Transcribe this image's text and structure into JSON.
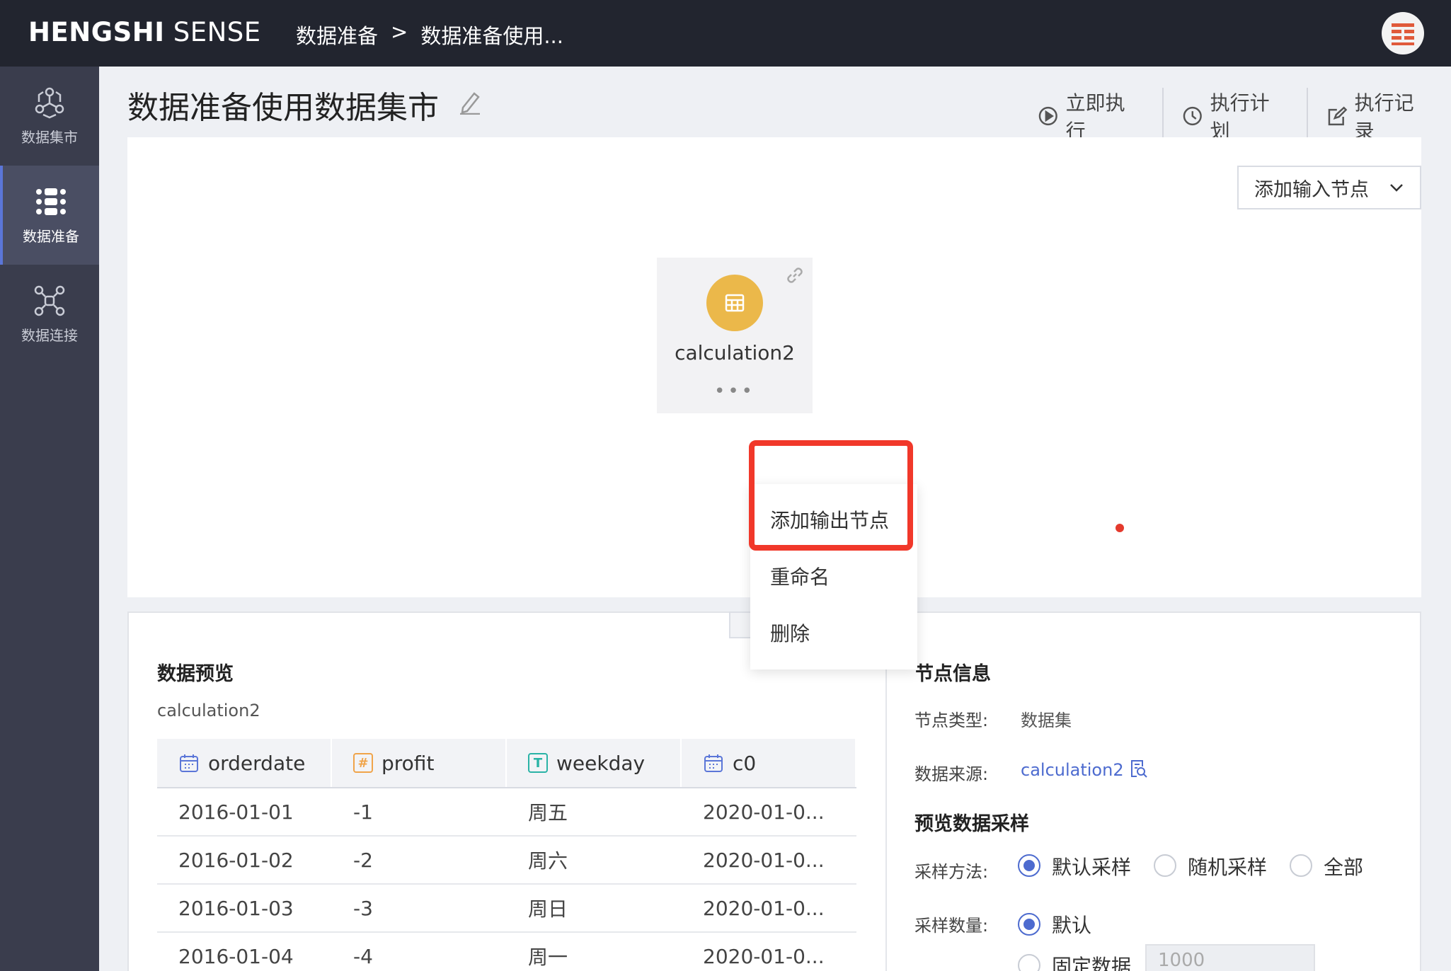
{
  "header": {
    "brand_bold": "HENGSHI",
    "brand_light": " SENSE",
    "breadcrumb": [
      "数据准备",
      ">",
      "数据准备使用..."
    ]
  },
  "sidebar": {
    "items": [
      {
        "label": "数据集市",
        "icon": "hex-network-icon",
        "active": false
      },
      {
        "label": "数据准备",
        "icon": "prep-flow-icon",
        "active": true
      },
      {
        "label": "数据连接",
        "icon": "connection-graph-icon",
        "active": false
      }
    ]
  },
  "page": {
    "title": "数据准备使用数据集市",
    "toolbar": {
      "run_now": "立即执行",
      "schedule": "执行计划",
      "log": "执行记录"
    }
  },
  "canvas": {
    "add_input_label": "添加输入节点",
    "node": {
      "label": "calculation2",
      "dots": "•••"
    },
    "menu": [
      "添加输出节点",
      "重命名",
      "删除"
    ]
  },
  "preview": {
    "title": "数据预览",
    "dataset": "calculation2",
    "columns": [
      {
        "name": "orderdate",
        "type": "date"
      },
      {
        "name": "profit",
        "type": "#"
      },
      {
        "name": "weekday",
        "type": "T"
      },
      {
        "name": "c0",
        "type": "date"
      }
    ],
    "rows": [
      [
        "2016-01-01",
        "-1",
        "周五",
        "2020-01-0..."
      ],
      [
        "2016-01-02",
        "-2",
        "周六",
        "2020-01-0..."
      ],
      [
        "2016-01-03",
        "-3",
        "周日",
        "2020-01-0..."
      ],
      [
        "2016-01-04",
        "-4",
        "周一",
        "2020-01-0..."
      ]
    ]
  },
  "node_info": {
    "title": "节点信息",
    "type_label": "节点类型:",
    "type_value": "数据集",
    "source_label": "数据来源:",
    "source_value": "calculation2",
    "sampling_title": "预览数据采样",
    "method_label": "采样方法:",
    "methods": [
      "默认采样",
      "随机采样",
      "全部"
    ],
    "count_label": "采样数量:",
    "counts": [
      "默认",
      "固定数据"
    ],
    "fixed_placeholder": "1000"
  },
  "colors": {
    "accent": "#4d6bcf",
    "node": "#ebb84a",
    "highlight": "#f1382a"
  }
}
